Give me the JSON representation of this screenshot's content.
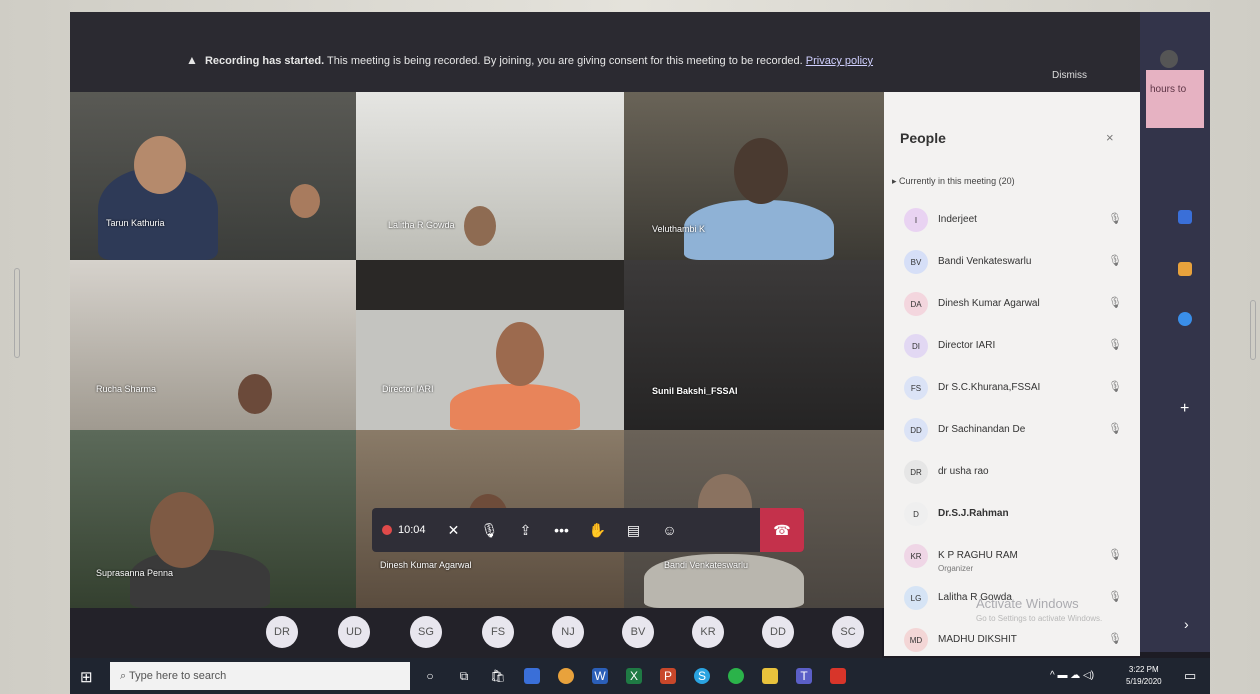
{
  "banner": {
    "bold": "Recording has started.",
    "text": "This meeting is being recorded. By joining, you are giving consent for this meeting to be recorded.",
    "link": "Privacy policy",
    "dismiss": "Dismiss"
  },
  "rail": {
    "pink_text": "hours to"
  },
  "tiles": [
    {
      "name": "Tarun Kathuria"
    },
    {
      "name": "Lalitha R Gowda"
    },
    {
      "name": "Veluthambi K"
    },
    {
      "name": "Rucha Sharma"
    },
    {
      "name": "Director IARI"
    },
    {
      "name": "Sunil Bakshi_FSSAI"
    },
    {
      "name": "Suprasanna Penna"
    },
    {
      "name": "Dinesh Kumar Agarwal"
    },
    {
      "name": "Bandi Venkateswarlu"
    }
  ],
  "controls": {
    "timer": "10:04"
  },
  "avatar_strip": [
    "DR",
    "UD",
    "SG",
    "FS",
    "NJ",
    "BV",
    "KR",
    "DD",
    "SC"
  ],
  "people": {
    "title": "People",
    "close": "×",
    "section": "Currently in this meeting (20)",
    "members": [
      {
        "initials": "I",
        "name": "Inderjeet",
        "color": "#e9d3f2"
      },
      {
        "initials": "BV",
        "name": "Bandi Venkateswarlu",
        "color": "#d6dff7"
      },
      {
        "initials": "DA",
        "name": "Dinesh Kumar Agarwal",
        "color": "#f3d6de"
      },
      {
        "initials": "DI",
        "name": "Director IARI",
        "color": "#e2d8f3"
      },
      {
        "initials": "FS",
        "name": "Dr S.C.Khurana,FSSAI",
        "color": "#dbe3f6"
      },
      {
        "initials": "DD",
        "name": "Dr Sachinandan De",
        "color": "#dbe3f6"
      },
      {
        "initials": "DR",
        "name": "dr usha rao",
        "color": "#e6e6e6"
      },
      {
        "initials": "D",
        "name": "Dr.S.J.Rahman",
        "color": "#efefef"
      },
      {
        "initials": "KR",
        "name": "K P RAGHU RAM",
        "sub": "Organizer",
        "color": "#efd6e6"
      },
      {
        "initials": "LG",
        "name": "Lalitha R Gowda",
        "color": "#d6e4f5"
      },
      {
        "initials": "MD",
        "name": "MADHU DIKSHIT",
        "color": "#f3d6d6"
      }
    ],
    "watermark": "Activate Windows",
    "watermark_sub": "Go to Settings to activate Windows."
  },
  "taskbar": {
    "search_placeholder": "Type here to search",
    "time": "3:22 PM",
    "date": "5/19/2020"
  },
  "colors": {
    "hangup": "#c4314b",
    "rail": "#33344a",
    "panel": "#f3f2f1"
  }
}
